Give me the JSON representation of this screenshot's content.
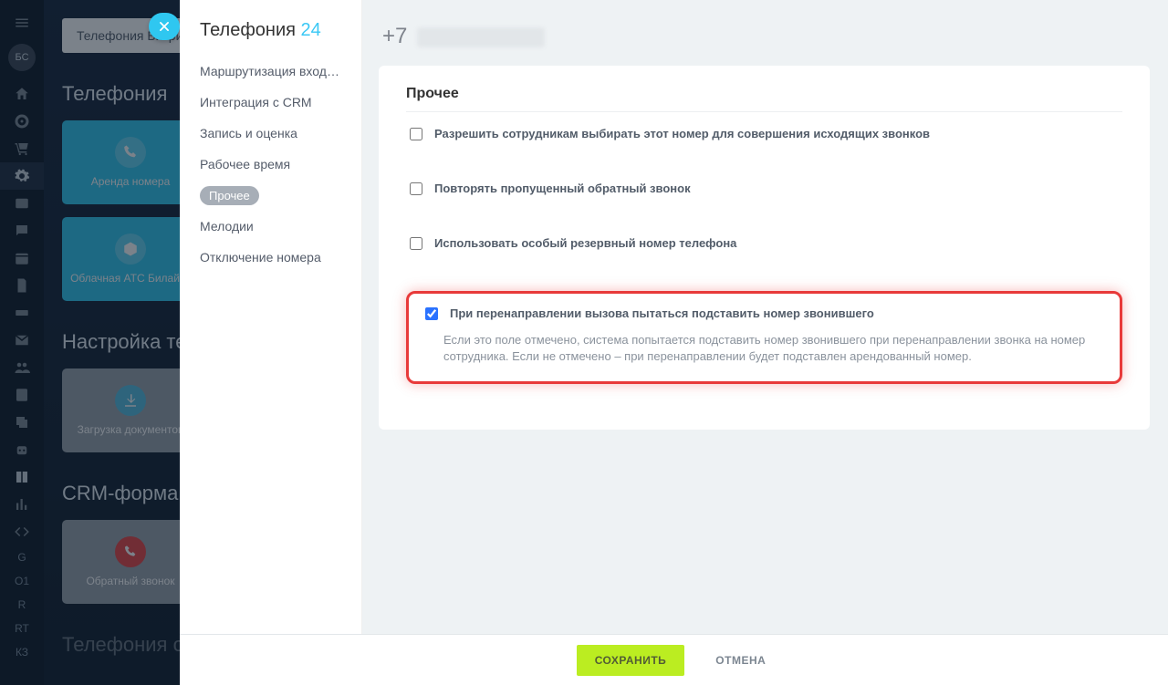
{
  "rail": {
    "avatar_initials": "БС",
    "letters": [
      "G",
      "O1",
      "R",
      "RT",
      "КЗ"
    ]
  },
  "background": {
    "breadcrumb": "Телефония Битрик",
    "section1_title": "Телефония",
    "tiles": [
      {
        "label": "Аренда номера"
      },
      {
        "label": "Облачная АТС Билай…"
      }
    ],
    "section2_title": "Настройка телефони",
    "tile_docs": "Загрузка документов",
    "section3_title": "CRM-форма на сайт",
    "tile_callback": "Обратный звонок",
    "section4_title": "Телефония от партне"
  },
  "panel": {
    "brand_prefix": "Телефония",
    "brand_suffix": "24",
    "nav": [
      "Маршрутизация входящ…",
      "Интеграция с CRM",
      "Запись и оценка",
      "Рабочее время",
      "Прочее",
      "Мелодии",
      "Отключение номера"
    ],
    "active_index": 4,
    "phone_prefix": "+7",
    "card_title": "Прочее",
    "options": [
      {
        "checked": false,
        "label": "Разрешить сотрудникам выбирать этот номер для совершения исходящих звонков"
      },
      {
        "checked": false,
        "label": "Повторять пропущенный обратный звонок"
      },
      {
        "checked": false,
        "label": "Использовать особый резервный номер телефона"
      },
      {
        "checked": true,
        "label": "При перенаправлении вызова пытаться подставить номер звонившего",
        "desc": "Если это поле отмечено, система попытается подставить номер звонившего при перенаправлении звонка на номер сотрудника. Если не отмечено – при перенаправлении будет подставлен арендованный номер."
      }
    ],
    "save_label": "СОХРАНИТЬ",
    "cancel_label": "ОТМЕНА"
  }
}
